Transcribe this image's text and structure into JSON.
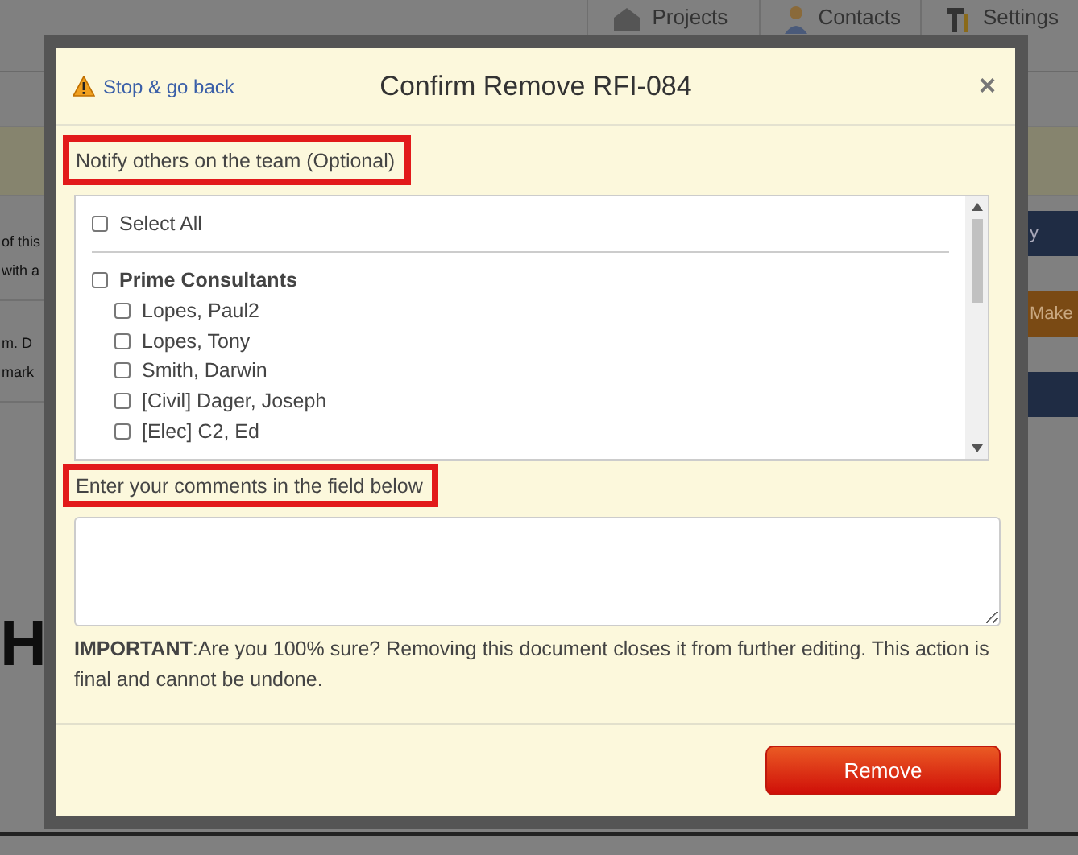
{
  "background": {
    "nav_tabs": [
      {
        "label": "Projects",
        "kind": "projects"
      },
      {
        "label": "Contacts",
        "kind": "contacts"
      },
      {
        "label": "Settings",
        "kind": "settings"
      }
    ],
    "text_groups": [
      [
        "of this",
        "with a"
      ],
      [
        "m. D",
        "mark"
      ]
    ],
    "button_fragments": [
      {
        "label": "y",
        "kind": "blue"
      },
      {
        "label": "Make",
        "kind": "orange"
      },
      {
        "kind": "blue"
      }
    ],
    "heading_fragment": "H"
  },
  "dialog": {
    "back_link": "Stop & go back",
    "title": "Confirm Remove RFI-084",
    "close": "×",
    "notify_label": "Notify others on the team (Optional)",
    "select_all": {
      "label": "Select All",
      "checked": false
    },
    "groups": [
      {
        "label": "Prime Consultants",
        "checked": false,
        "members": [
          {
            "label": "Lopes, Paul2",
            "checked": false
          },
          {
            "label": "Lopes, Tony",
            "checked": false
          },
          {
            "label": "Smith, Darwin",
            "checked": false
          },
          {
            "label": "[Civil] Dager, Joseph",
            "checked": false
          },
          {
            "label": "[Elec] C2, Ed",
            "checked": false
          }
        ]
      }
    ],
    "comments_label": "Enter your comments in the field below",
    "comments": {
      "kind": "textarea"
    },
    "important_lead": "IMPORTANT",
    "important_text": ":Are you 100% sure? Removing this document closes it from further editing. This action is final and cannot be undone.",
    "buttons": [
      {
        "label": "Remove",
        "kind": "danger"
      }
    ]
  }
}
